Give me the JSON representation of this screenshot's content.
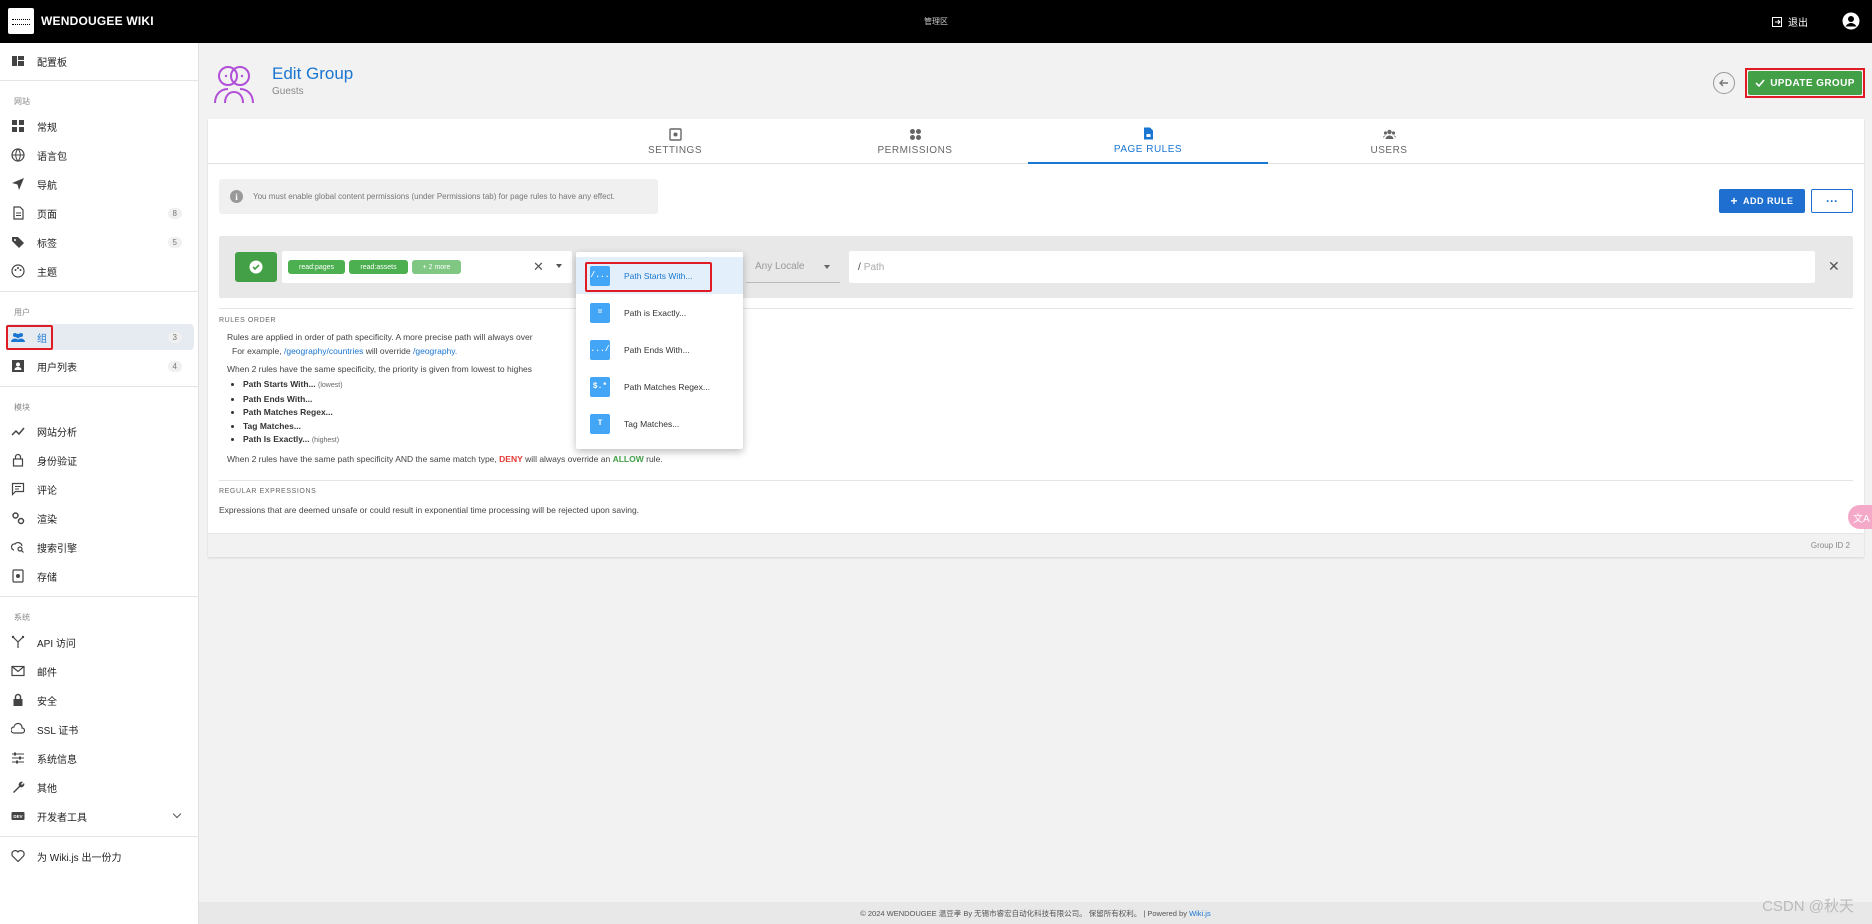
{
  "app": {
    "brand": "WENDOUGEE WIKI",
    "admin_center": "管理区",
    "logout": "退出"
  },
  "sidebar": {
    "dashboard": "配置板",
    "section_site": "网站",
    "general": "常规",
    "locale": "语言包",
    "navigation": "导航",
    "pages": "页面",
    "pages_count": "8",
    "tags": "标签",
    "tags_count": "5",
    "theme": "主题",
    "section_users": "用户",
    "groups": "组",
    "groups_count": "3",
    "users": "用户列表",
    "users_count": "4",
    "section_modules": "模块",
    "analytics": "网站分析",
    "auth": "身份验证",
    "comments": "评论",
    "rendering": "渲染",
    "search": "搜索引擎",
    "storage": "存储",
    "section_system": "系统",
    "api": "API 访问",
    "mail": "邮件",
    "security": "安全",
    "ssl": "SSL 证书",
    "system_info": "系统信息",
    "utilities": "其他",
    "dev_tools": "开发者工具",
    "contribute": "为 Wiki.js 出一份力"
  },
  "header": {
    "title": "Edit Group",
    "subtitle": "Guests",
    "update_btn": "UPDATE GROUP"
  },
  "tabs": {
    "settings": "SETTINGS",
    "permissions": "PERMISSIONS",
    "page_rules": "PAGE RULES",
    "users": "USERS"
  },
  "page_rules": {
    "alert": "You must enable global content permissions (under Permissions tab) for page rules to have any effect.",
    "add_rule": "ADD RULE",
    "more": "···",
    "chips": [
      "read:pages",
      "read:assets",
      "+ 2 more"
    ],
    "locale_placeholder": "Any Locale",
    "path_prefix": "/",
    "path_placeholder": "Path"
  },
  "menu": [
    "Path Starts With...",
    "Path is Exactly...",
    "Path Ends With...",
    "Path Matches Regex...",
    "Tag Matches..."
  ],
  "menu_icons": [
    "/...",
    "=",
    ".../",
    "$.*",
    "T"
  ],
  "rules_order": {
    "header": "RULES ORDER",
    "p1_a": "Rules are applied in order of path specificity. A more precise path will always over",
    "p1_b": "For example,",
    "p1_link1": "/geography/countries",
    "p1_c": "will override",
    "p1_link2": "/geography.",
    "p2": "When 2 rules have the same specificity, the priority is given from lowest to highes",
    "list": [
      "Path Starts With...",
      "Path Ends With...",
      "Path Matches Regex...",
      "Tag Matches...",
      "Path Is Exactly..."
    ],
    "lowest": "(lowest)",
    "highest": "(highest)",
    "p3_a": "When 2 rules have the same path specificity AND the same match type,",
    "p3_deny": "DENY",
    "p3_b": "will always override an",
    "p3_allow": "ALLOW",
    "p3_c": "rule."
  },
  "regex": {
    "header": "REGULAR EXPRESSIONS",
    "text": "Expressions that are deemed unsafe or could result in exponential time processing will be rejected upon saving."
  },
  "group_id": "Group ID 2",
  "footer": {
    "text": "© 2024 WENDOUGEE 温豆孝 By 无锡市睿宏自动化科技有限公司。 保留所有权利。 | Powered by",
    "link": "Wiki.js"
  },
  "watermark": "CSDN @秋天",
  "float_label": "文A"
}
